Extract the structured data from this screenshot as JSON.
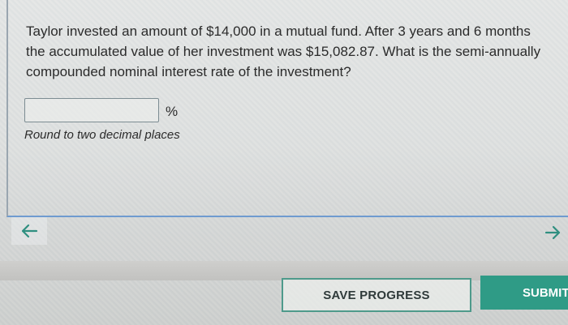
{
  "question": {
    "text": "Taylor invested an amount of $14,000 in a mutual fund. After 3 years and 6 months the accumulated value of her investment was $15,082.87. What is the semi-annually compounded nominal interest rate of the investment?"
  },
  "answer": {
    "value": "",
    "unit": "%",
    "hint": "Round to two decimal places"
  },
  "navigation": {
    "prev_icon": "arrow-left-icon",
    "next_icon": "arrow-right-icon"
  },
  "actions": {
    "save_label": "SAVE PROGRESS",
    "submit_label": "SUBMIT A"
  },
  "colors": {
    "accent": "#2f9b86",
    "save_border": "#4e9a8b",
    "card_border": "#6f9bd0"
  }
}
